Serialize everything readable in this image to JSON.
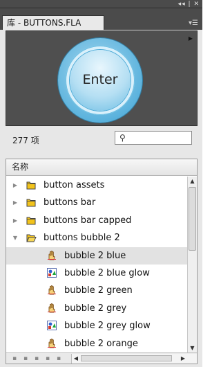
{
  "window": {
    "controls": "◂◂ | ✕"
  },
  "tab": {
    "title": "库 - BUTTONS.FLA"
  },
  "preview": {
    "symbol_text": "Enter"
  },
  "library": {
    "item_count": "277 项",
    "search_placeholder": "",
    "column_name": "名称",
    "items": [
      {
        "label": "button assets",
        "type": "folder",
        "expanded": false
      },
      {
        "label": "buttons bar",
        "type": "folder",
        "expanded": false
      },
      {
        "label": "buttons bar capped",
        "type": "folder",
        "expanded": false
      },
      {
        "label": "buttons bubble 2",
        "type": "folder-open",
        "expanded": true
      },
      {
        "label": "bubble 2 blue",
        "type": "button-symbol",
        "selected": true
      },
      {
        "label": "bubble 2 blue glow",
        "type": "graphic-symbol"
      },
      {
        "label": "bubble 2 green",
        "type": "button-symbol"
      },
      {
        "label": "bubble 2 grey",
        "type": "button-symbol"
      },
      {
        "label": "bubble 2 grey glow",
        "type": "graphic-symbol"
      },
      {
        "label": "bubble 2 orange",
        "type": "button-symbol"
      }
    ]
  },
  "colors": {
    "accent": "#5cb3dd",
    "folder": "#f2c31b",
    "selection": "#e2e2e2"
  }
}
